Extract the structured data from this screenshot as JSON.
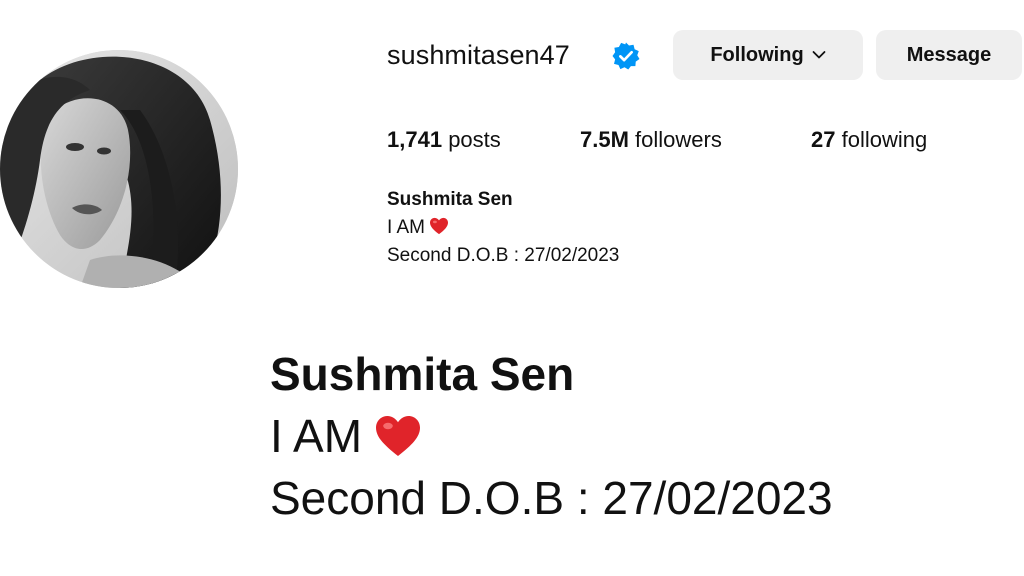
{
  "profile": {
    "username": "sushmitasen47",
    "verified": true,
    "avatar_icon": "profile-photo"
  },
  "actions": {
    "following_label": "Following",
    "message_label": "Message"
  },
  "stats": {
    "posts_count": "1,741",
    "posts_label": "posts",
    "followers_count": "7.5M",
    "followers_label": "followers",
    "following_count": "27",
    "following_label": "following"
  },
  "bio": {
    "name": "Sushmita Sen",
    "line1": "I AM",
    "line1_emoji": "red-heart",
    "line2": "Second D.O.B : 27/02/2023"
  },
  "bio_zoom": {
    "name": "Sushmita Sen",
    "line1": "I AM",
    "line1_emoji": "red-heart",
    "line2": "Second D.O.B : 27/02/2023"
  },
  "colors": {
    "verified_badge": "#0095f6",
    "button_bg": "#efefef",
    "heart": "#e0242a"
  }
}
